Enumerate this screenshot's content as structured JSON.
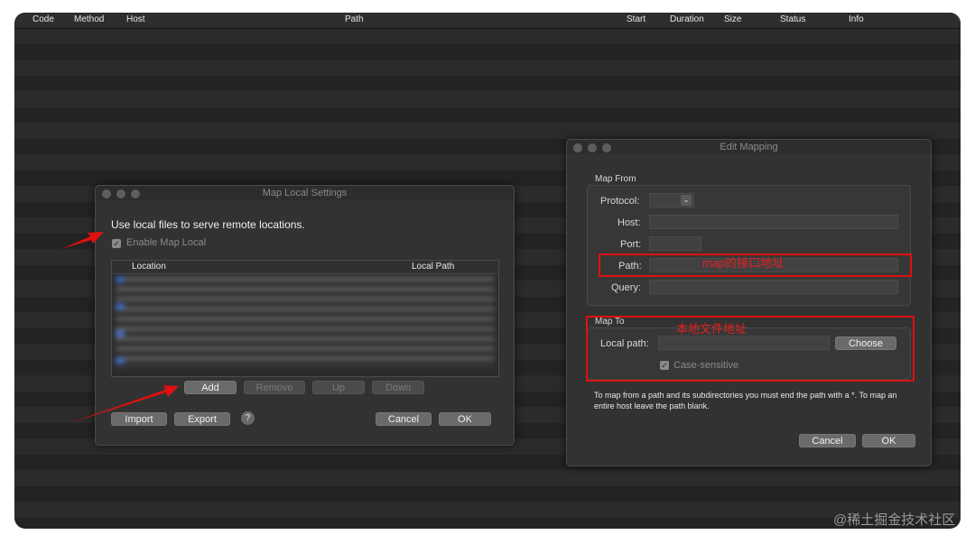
{
  "table_header": {
    "columns": [
      "Code",
      "Method",
      "Host",
      "Path",
      "Start",
      "Duration",
      "Size",
      "Status",
      "Info"
    ]
  },
  "map_local_settings": {
    "title": "Map Local Settings",
    "description": "Use local files to serve remote locations.",
    "enable_label": "Enable Map Local",
    "enable_checked": true,
    "columns": {
      "location": "Location",
      "local_path": "Local Path"
    },
    "buttons": {
      "add": "Add",
      "remove": "Remove",
      "up": "Up",
      "down": "Down",
      "import": "Import",
      "export": "Export",
      "help": "?",
      "cancel": "Cancel",
      "ok": "OK"
    }
  },
  "edit_mapping": {
    "title": "Edit Mapping",
    "map_from": {
      "legend": "Map From",
      "protocol_label": "Protocol:",
      "host_label": "Host:",
      "port_label": "Port:",
      "path_label": "Path:",
      "query_label": "Query:"
    },
    "map_to": {
      "legend": "Map To",
      "local_path_label": "Local path:",
      "choose_button": "Choose",
      "case_sensitive_label": "Case-sensitive",
      "case_sensitive_checked": true
    },
    "help_text": "To map from a path and its subdirectories you must end the path with a *. To map an entire host leave the path blank.",
    "buttons": {
      "cancel": "Cancel",
      "ok": "OK"
    }
  },
  "annotations": {
    "path_note": "map的接口地址",
    "local_note": "本地文件地址",
    "color": "#e01010"
  },
  "watermark": "@稀土掘金技术社区",
  "icons": {
    "dropdown": "chevron-down-icon",
    "check": "checkmark-icon",
    "help": "question-icon"
  }
}
